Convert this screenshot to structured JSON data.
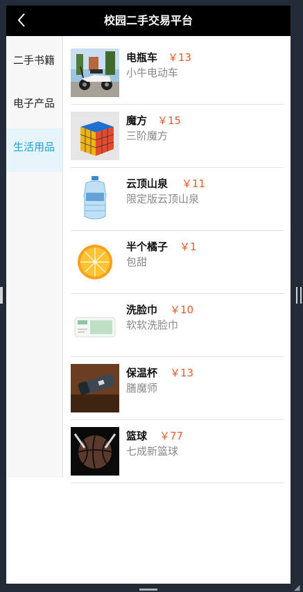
{
  "app": {
    "title": "校园二手交易平台",
    "back_icon": "chevron-left-icon"
  },
  "sidebar": {
    "items": [
      {
        "label": "二手书籍",
        "active": false
      },
      {
        "label": "电子产品",
        "active": false
      },
      {
        "label": "生活用品",
        "active": true
      }
    ]
  },
  "products": [
    {
      "name": "电瓶车",
      "price": "￥13",
      "desc": "小牛电动车",
      "image": "electric-scooter"
    },
    {
      "name": "魔方",
      "price": "￥15",
      "desc": "三阶魔方",
      "image": "rubiks-cube"
    },
    {
      "name": "云顶山泉",
      "price": "￥11",
      "desc": "限定版云顶山泉",
      "image": "water-jug"
    },
    {
      "name": "半个橘子",
      "price": "￥1",
      "desc": "包甜",
      "image": "orange-half"
    },
    {
      "name": "洗脸巾",
      "price": "￥10",
      "desc": "软软洗脸巾",
      "image": "face-towel-pack"
    },
    {
      "name": "保温杯",
      "price": "￥13",
      "desc": "膳魔师",
      "image": "thermos-bottle"
    },
    {
      "name": "篮球",
      "price": "￥77",
      "desc": "七成新篮球",
      "image": "basketball"
    }
  ],
  "colors": {
    "navbar": "#000000",
    "accent": "#1ea0d8",
    "price": "#e85b2a"
  }
}
